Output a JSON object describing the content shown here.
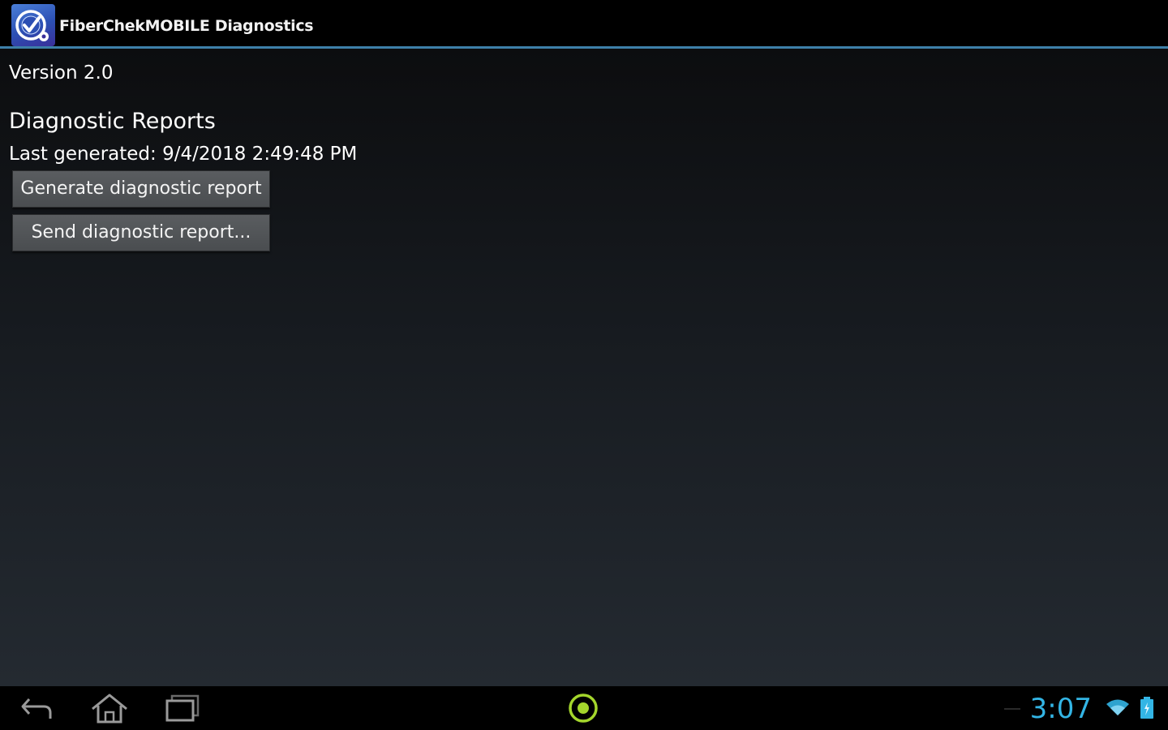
{
  "app": {
    "title": "FiberChekMOBILE Diagnostics",
    "icon": "fiberchek-app-icon"
  },
  "main": {
    "version_text": "Version 2.0",
    "section_title": "Diagnostic Reports",
    "last_generated_text": "Last generated: 9/4/2018 2:49:48 PM",
    "generate_button_label": "Generate diagnostic report",
    "send_button_label": "Send diagnostic report..."
  },
  "system_bar": {
    "time": "3:07",
    "icons": [
      "back-icon",
      "home-icon",
      "recent-apps-icon",
      "circle-icon",
      "wifi-icon",
      "battery-icon"
    ],
    "clock_color": "#33b5e5"
  },
  "colors": {
    "accent_line": "#3d7fa8",
    "button_bg": "#55585b",
    "center_icon": "#a4d62c"
  }
}
